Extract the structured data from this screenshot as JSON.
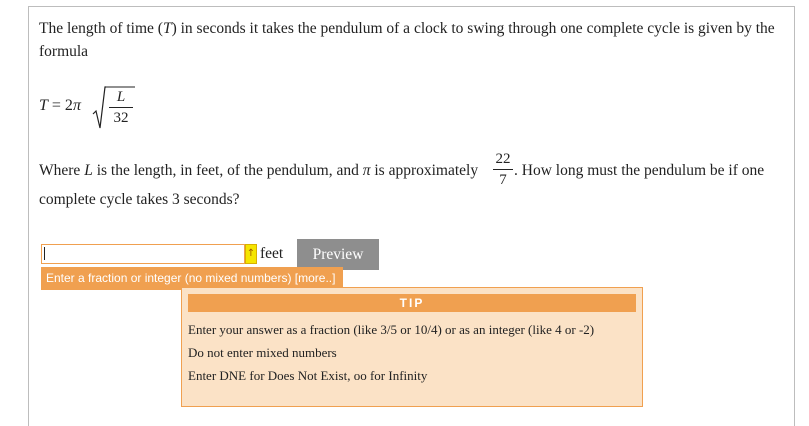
{
  "question": {
    "p1": "The length of time (T) in seconds it takes the pendulum of a clock to swing through one complete cycle is given by the formula",
    "p1_parts": [
      "The length of time (",
      "T",
      ") in seconds it takes the pendulum of a clock to swing through one complete cycle is given by the formula"
    ],
    "formula": {
      "lhs_var": "T",
      "eq": " = 2",
      "pi": "π",
      "frac_num": "L",
      "frac_den": "32"
    },
    "p2": {
      "a": "Where ",
      "L": "L",
      "b": " is the length, in feet, of the pendulum, and ",
      "pi": "π",
      "c": " is approximately ",
      "frac_num": "22",
      "frac_den": "7",
      "d": ". How long must the pendulum be if one",
      "e": "complete cycle takes ",
      "seconds": "3",
      "f": " seconds?"
    }
  },
  "answer": {
    "value": "",
    "arrow_glyph": "↑",
    "unit": "feet",
    "preview_label": "Preview",
    "hint": "Enter a fraction or integer (no mixed numbers) [more..]"
  },
  "tip": {
    "title": "TIP",
    "lines": [
      "Enter your answer as a fraction (like 3/5 or 10/4) or as an integer (like 4 or -2)",
      "Do not enter mixed numbers",
      "Enter DNE for Does Not Exist, oo for Infinity"
    ]
  },
  "colors": {
    "accent": "#f0a050",
    "tip_bg": "#fbe2c6",
    "preview_bg": "#8e8e8e",
    "arrow_bg": "#f5e500"
  }
}
